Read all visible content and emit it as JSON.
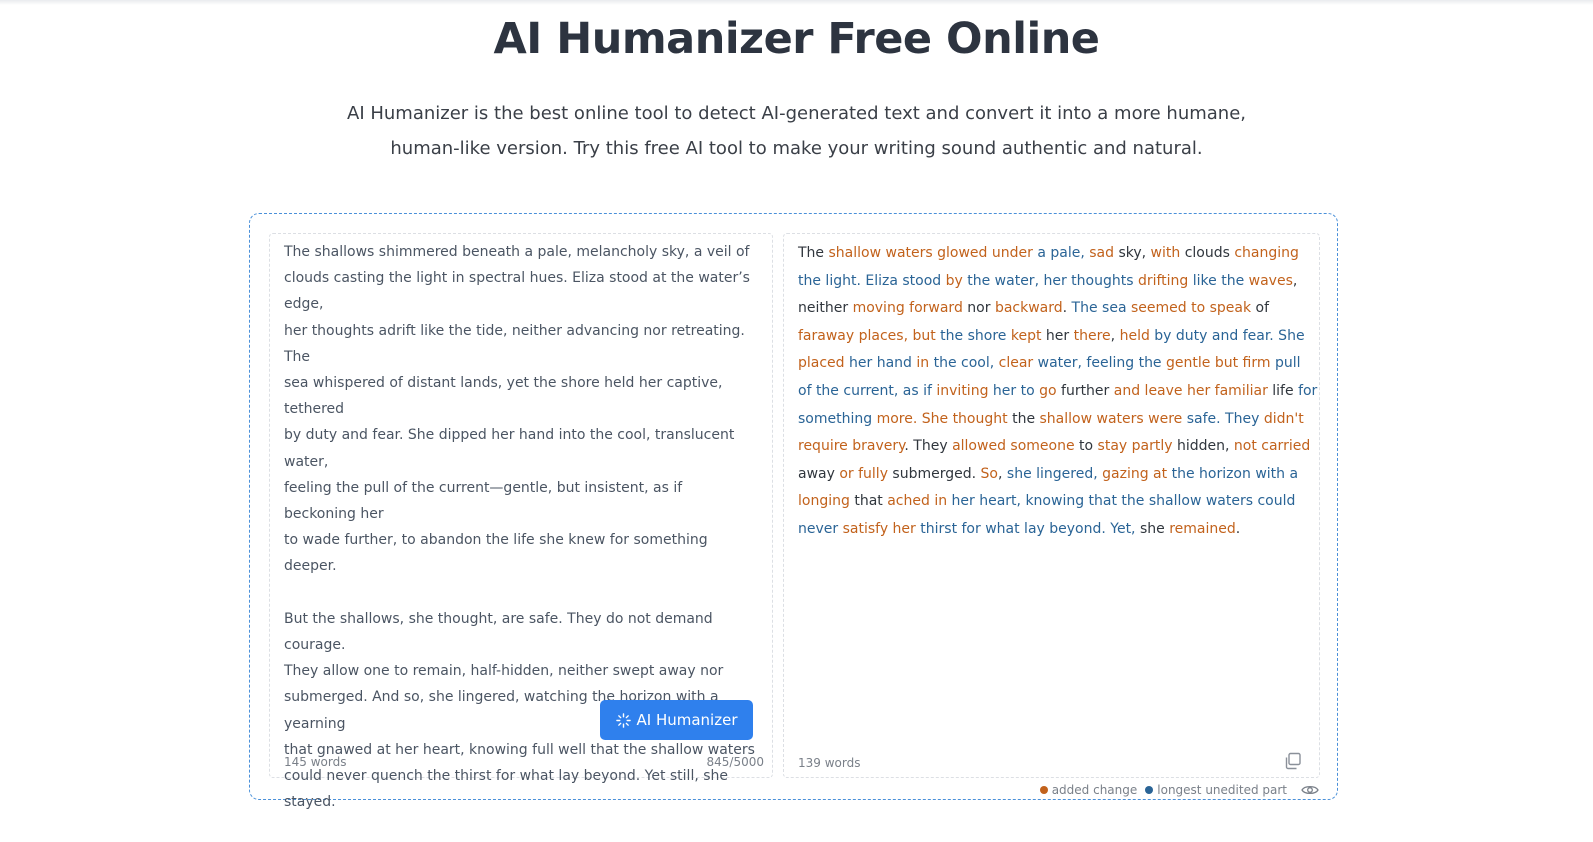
{
  "header": {
    "title": "AI Humanizer Free Online",
    "subtitle": "AI Humanizer is the best online tool to detect AI-generated text and convert it into a more humane, human-like version. Try this free AI tool to make your writing sound authentic and natural."
  },
  "input": {
    "paragraphs": [
      "The shallows shimmered beneath a pale, melancholy sky, a veil of\nclouds casting the light in spectral hues. Eliza stood at the water’s edge,\nher thoughts adrift like the tide, neither advancing nor retreating. The\nsea whispered of distant lands, yet the shore held her captive, tethered\nby duty and fear. She dipped her hand into the cool, translucent water,\nfeeling the pull of the current—gentle, but insistent, as if beckoning her\nto wade further, to abandon the life she knew for something deeper.",
      "But the shallows, she thought, are safe. They do not demand courage.\nThey allow one to remain, half-hidden, neither swept away nor\nsubmerged. And so, she lingered, watching the horizon with a yearning\nthat gnawed at her heart, knowing full well that the shallow waters\ncould never quench the thirst for what lay beyond. Yet still, she stayed."
    ],
    "word_count": "145 words",
    "char_count": "845/5000",
    "button_label": "AI Humanizer"
  },
  "output": {
    "segments": [
      {
        "t": "The ",
        "k": "plain"
      },
      {
        "t": "shallow waters glowed under",
        "k": "added"
      },
      {
        "t": " ",
        "k": "plain"
      },
      {
        "t": "a pale,",
        "k": "unedited"
      },
      {
        "t": " ",
        "k": "plain"
      },
      {
        "t": "sad",
        "k": "added"
      },
      {
        "t": " sky, ",
        "k": "plain"
      },
      {
        "t": "with",
        "k": "added"
      },
      {
        "t": " clouds ",
        "k": "plain"
      },
      {
        "t": "changing",
        "k": "added"
      },
      {
        "t": " ",
        "k": "plain"
      },
      {
        "t": "the light. Eliza stood",
        "k": "unedited"
      },
      {
        "t": " ",
        "k": "plain"
      },
      {
        "t": "by",
        "k": "added"
      },
      {
        "t": " ",
        "k": "plain"
      },
      {
        "t": "the water, her thoughts",
        "k": "unedited"
      },
      {
        "t": " ",
        "k": "plain"
      },
      {
        "t": "drifting",
        "k": "added"
      },
      {
        "t": " ",
        "k": "plain"
      },
      {
        "t": "like the",
        "k": "unedited"
      },
      {
        "t": " ",
        "k": "plain"
      },
      {
        "t": "waves",
        "k": "added"
      },
      {
        "t": ", neither ",
        "k": "plain"
      },
      {
        "t": "moving forward",
        "k": "added"
      },
      {
        "t": " nor ",
        "k": "plain"
      },
      {
        "t": "backward",
        "k": "added"
      },
      {
        "t": ". ",
        "k": "plain"
      },
      {
        "t": "The sea",
        "k": "unedited"
      },
      {
        "t": " ",
        "k": "plain"
      },
      {
        "t": "seemed to speak",
        "k": "added"
      },
      {
        "t": " of ",
        "k": "plain"
      },
      {
        "t": "faraway places, but",
        "k": "added"
      },
      {
        "t": " ",
        "k": "plain"
      },
      {
        "t": "the shore",
        "k": "unedited"
      },
      {
        "t": " ",
        "k": "plain"
      },
      {
        "t": "kept",
        "k": "added"
      },
      {
        "t": " her ",
        "k": "plain"
      },
      {
        "t": "there",
        "k": "added"
      },
      {
        "t": ", ",
        "k": "plain"
      },
      {
        "t": "held",
        "k": "added"
      },
      {
        "t": " ",
        "k": "plain"
      },
      {
        "t": "by duty and fear. She",
        "k": "unedited"
      },
      {
        "t": " ",
        "k": "plain"
      },
      {
        "t": "placed",
        "k": "added"
      },
      {
        "t": " ",
        "k": "plain"
      },
      {
        "t": "her hand",
        "k": "unedited"
      },
      {
        "t": " ",
        "k": "plain"
      },
      {
        "t": "in",
        "k": "added"
      },
      {
        "t": " ",
        "k": "plain"
      },
      {
        "t": "the cool,",
        "k": "unedited"
      },
      {
        "t": " ",
        "k": "plain"
      },
      {
        "t": "clear",
        "k": "added"
      },
      {
        "t": " ",
        "k": "plain"
      },
      {
        "t": "water, feeling the",
        "k": "unedited"
      },
      {
        "t": " ",
        "k": "plain"
      },
      {
        "t": "gentle but firm",
        "k": "added"
      },
      {
        "t": " ",
        "k": "plain"
      },
      {
        "t": "pull of the current, as if",
        "k": "unedited"
      },
      {
        "t": " ",
        "k": "plain"
      },
      {
        "t": "inviting",
        "k": "added"
      },
      {
        "t": " ",
        "k": "plain"
      },
      {
        "t": "her to",
        "k": "unedited"
      },
      {
        "t": " ",
        "k": "plain"
      },
      {
        "t": "go",
        "k": "added"
      },
      {
        "t": " further ",
        "k": "plain"
      },
      {
        "t": "and leave her familiar",
        "k": "added"
      },
      {
        "t": " life ",
        "k": "plain"
      },
      {
        "t": "for something",
        "k": "unedited"
      },
      {
        "t": " ",
        "k": "plain"
      },
      {
        "t": "more. She thought",
        "k": "added"
      },
      {
        "t": " the ",
        "k": "plain"
      },
      {
        "t": "shallow waters were",
        "k": "added"
      },
      {
        "t": " ",
        "k": "plain"
      },
      {
        "t": "safe. They",
        "k": "unedited"
      },
      {
        "t": " ",
        "k": "plain"
      },
      {
        "t": "didn't require bravery",
        "k": "added"
      },
      {
        "t": ". They ",
        "k": "plain"
      },
      {
        "t": "allowed someone",
        "k": "added"
      },
      {
        "t": " to ",
        "k": "plain"
      },
      {
        "t": "stay partly",
        "k": "added"
      },
      {
        "t": " hidden, ",
        "k": "plain"
      },
      {
        "t": "not carried",
        "k": "added"
      },
      {
        "t": " away ",
        "k": "plain"
      },
      {
        "t": "or fully",
        "k": "added"
      },
      {
        "t": " submerged. ",
        "k": "plain"
      },
      {
        "t": "So",
        "k": "added"
      },
      {
        "t": ", ",
        "k": "plain"
      },
      {
        "t": "she lingered,",
        "k": "unedited"
      },
      {
        "t": " ",
        "k": "plain"
      },
      {
        "t": "gazing at",
        "k": "added"
      },
      {
        "t": " ",
        "k": "plain"
      },
      {
        "t": "the horizon with a",
        "k": "unedited"
      },
      {
        "t": " ",
        "k": "plain"
      },
      {
        "t": "longing",
        "k": "added"
      },
      {
        "t": " that ",
        "k": "plain"
      },
      {
        "t": "ached in",
        "k": "added"
      },
      {
        "t": " ",
        "k": "plain"
      },
      {
        "t": "her heart, knowing that the shallow waters could never",
        "k": "unedited"
      },
      {
        "t": " ",
        "k": "plain"
      },
      {
        "t": "satisfy her",
        "k": "added"
      },
      {
        "t": " ",
        "k": "plain"
      },
      {
        "t": "thirst for what lay beyond. Yet,",
        "k": "unedited"
      },
      {
        "t": " she ",
        "k": "plain"
      },
      {
        "t": "remained",
        "k": "added"
      },
      {
        "t": ".",
        "k": "plain"
      }
    ],
    "word_count": "139 words"
  },
  "legend": {
    "added_label": "added change",
    "unedited_label": "longest unedited part",
    "added_color": "#c2621c",
    "unedited_color": "#2a6496"
  },
  "icons": {
    "button_icon": "sparkle-icon",
    "copy_icon": "copy-icon",
    "toggle_icon": "eye-icon"
  }
}
